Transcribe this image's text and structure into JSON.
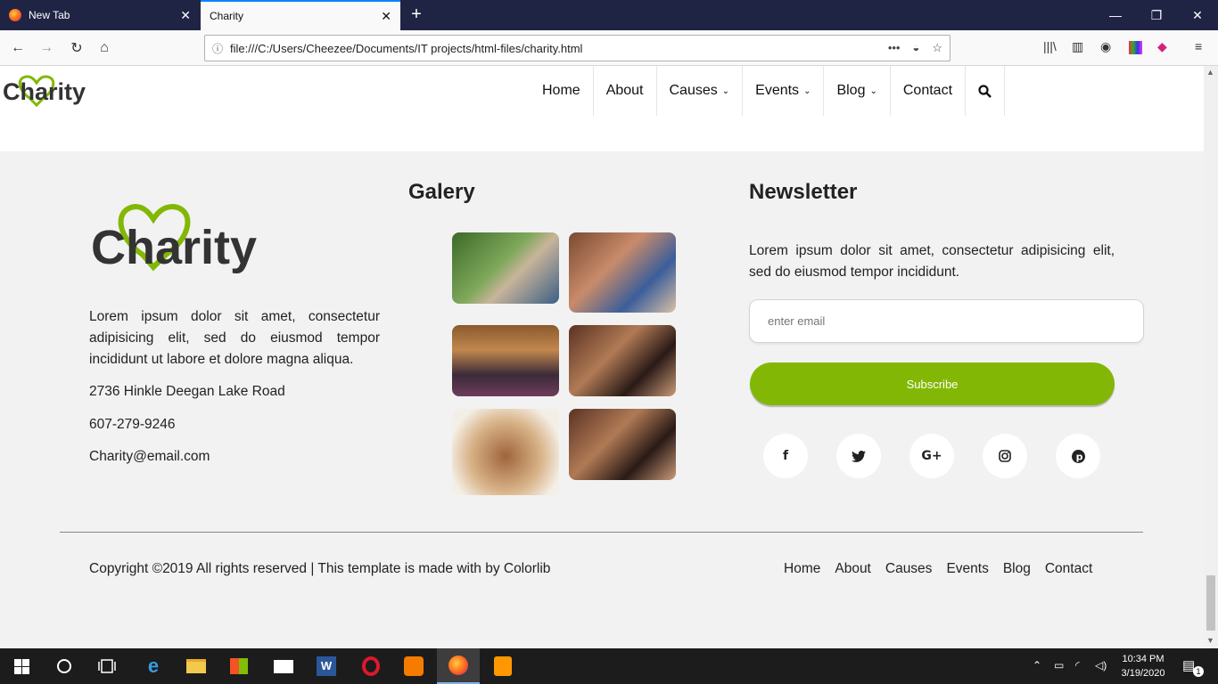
{
  "browser": {
    "tabs": [
      {
        "title": "New Tab",
        "active": false
      },
      {
        "title": "Charity",
        "active": true
      }
    ],
    "url": "file:///C:/Users/Cheezee/Documents/IT projects/html-files/charity.html"
  },
  "header": {
    "logo_text": "Charity",
    "menu": [
      {
        "label": "Home",
        "has_dropdown": false
      },
      {
        "label": "About",
        "has_dropdown": false
      },
      {
        "label": "Causes",
        "has_dropdown": true
      },
      {
        "label": "Events",
        "has_dropdown": true
      },
      {
        "label": "Blog",
        "has_dropdown": true
      },
      {
        "label": "Contact",
        "has_dropdown": false
      }
    ]
  },
  "footer": {
    "about": {
      "logo_text": "Charity",
      "text": "Lorem ipsum dolor sit amet, consectetur adipisicing elit, sed do eiusmod tempor incididunt ut labore et dolore magna aliqua.",
      "address": "2736 Hinkle Deegan Lake Road",
      "phone": "607-279-9246",
      "email": "Charity@email.com"
    },
    "gallery": {
      "title": "Galery",
      "images": [
        "child-in-field",
        "group-of-children",
        "classroom",
        "smiling-children",
        "child-portrait",
        "smiling-children"
      ]
    },
    "newsletter": {
      "title": "Newsletter",
      "text": "Lorem ipsum dolor sit amet, consectetur adipisicing elit, sed do eiusmod tempor incididunt.",
      "email_placeholder": "enter email",
      "subscribe_label": "Subscribe",
      "social": [
        "facebook-icon",
        "twitter-icon",
        "google-plus-icon",
        "instagram-icon",
        "pinterest-icon"
      ]
    },
    "copyright": "Copyright ©2019 All rights reserved | This template is made with by Colorlib",
    "menu": [
      "Home",
      "About",
      "Causes",
      "Events",
      "Blog",
      "Contact"
    ]
  },
  "taskbar": {
    "time": "10:34 PM",
    "date": "3/19/2020",
    "notification_count": "1"
  },
  "colors": {
    "accent_green": "#82b805",
    "tabbar": "#1f2444",
    "footer_bg": "#f2f2f2"
  }
}
